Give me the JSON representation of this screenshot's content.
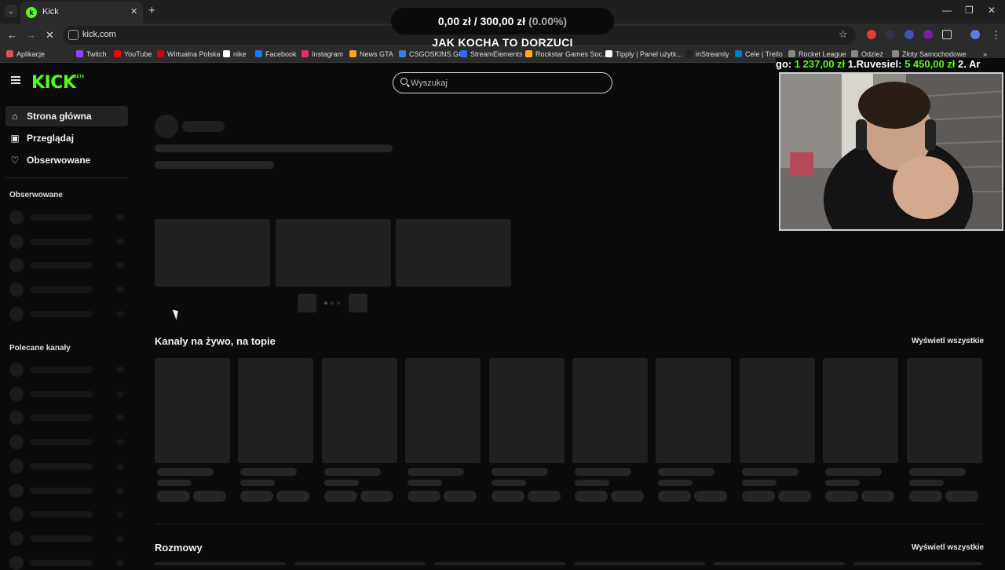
{
  "browser": {
    "tab_title": "Kick",
    "url": "kick.com",
    "bookmarks": [
      {
        "label": "Aplikacje",
        "color": "#d9534f"
      },
      {
        "label": "Twitch",
        "color": "#9146ff"
      },
      {
        "label": "YouTube",
        "color": "#ff0000"
      },
      {
        "label": "Wirtualna Polska",
        "color": "#d0021b"
      },
      {
        "label": "nike",
        "color": "#ffffff"
      },
      {
        "label": "Facebook",
        "color": "#1877f2"
      },
      {
        "label": "Instagram",
        "color": "#e1306c"
      },
      {
        "label": "News GTA",
        "color": "#f5a623"
      },
      {
        "label": "CSGOSKINS.GG",
        "color": "#3b7ddd"
      },
      {
        "label": "StreamElements",
        "color": "#2f6fed"
      },
      {
        "label": "Rockstar Games Soc...",
        "color": "#fcaf17"
      },
      {
        "label": "Tipply | Panel użytk...",
        "color": "#ffffff"
      },
      {
        "label": "inStreamly",
        "color": "#222222"
      },
      {
        "label": "Cele | Trello",
        "color": "#0079bf"
      },
      {
        "label": "Rocket League",
        "color": "#888888"
      },
      {
        "label": "Odzież",
        "color": "#888888"
      },
      {
        "label": "Złoty Samochodowe",
        "color": "#888888"
      }
    ]
  },
  "overlay": {
    "donation_amount": "0,00 zł",
    "donation_sep": "/",
    "donation_goal": "300,00 zł",
    "donation_percent": "(0.00%)",
    "donation_caption": "JAK KOCHA TO DORZUCI",
    "ticker_prefix": "go:",
    "ticker_amount1": "1 237,00 zł",
    "ticker_rank1": "1.",
    "ticker_name1": "Ruvesiel:",
    "ticker_amount2": "5 450,00 zł",
    "ticker_tail": "2. Ar"
  },
  "kick": {
    "logo": "KICK",
    "beta": "BETA",
    "search_placeholder": "Wyszukaj",
    "nav": [
      {
        "label": "Strona główna",
        "icon": "home-icon"
      },
      {
        "label": "Przeglądaj",
        "icon": "browse-icon"
      },
      {
        "label": "Obserwowane",
        "icon": "heart-icon"
      }
    ],
    "following_heading": "Obserwowane",
    "recommended_heading": "Polecane kanały",
    "live_section_title": "Kanały na żywo, na topie",
    "show_all": "Wyświetl wszystkie",
    "talk_section_title": "Rozmowy",
    "accent": "#53fc18"
  }
}
